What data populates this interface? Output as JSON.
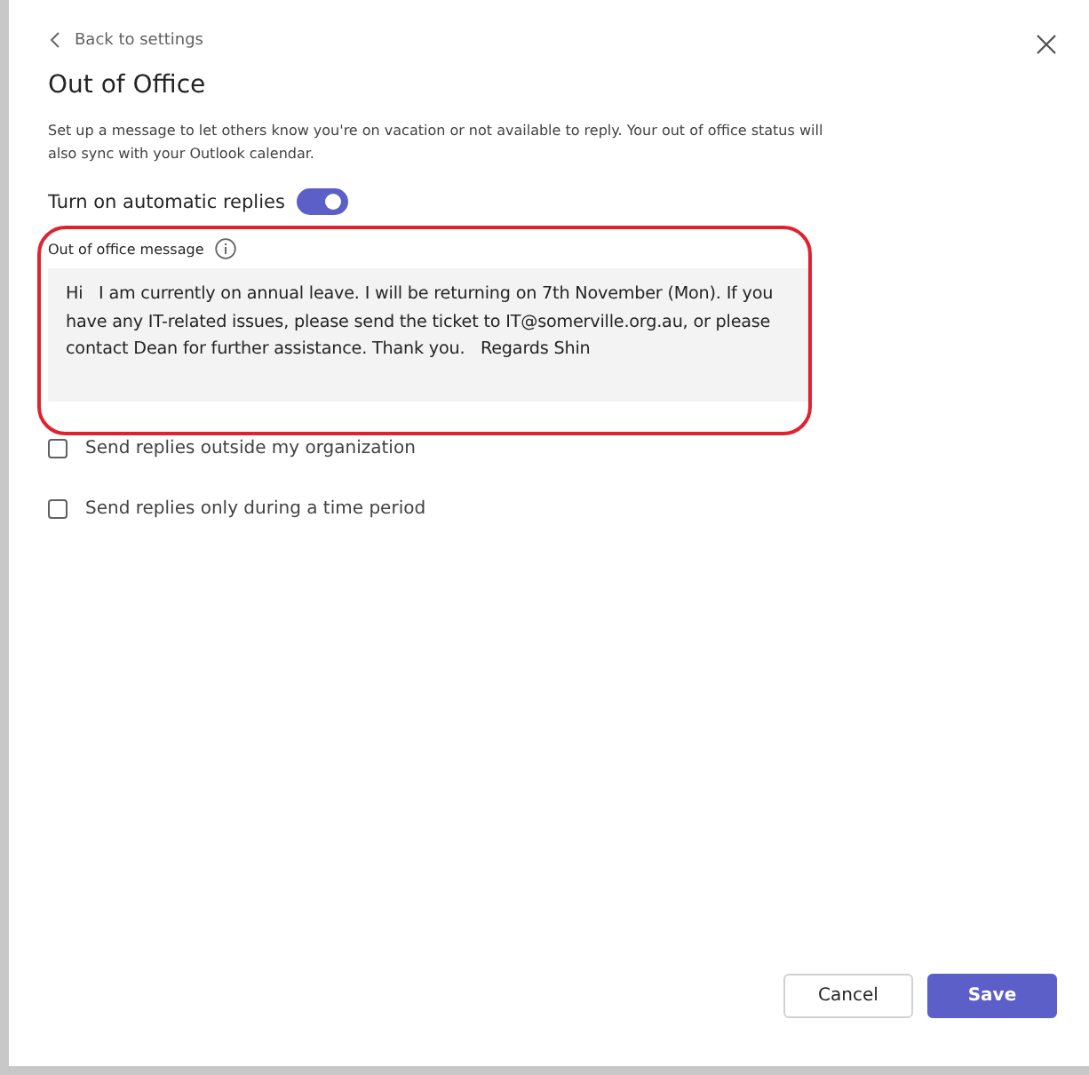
{
  "back_link": {
    "label": "Back to settings"
  },
  "title": "Out of Office",
  "description": "Set up a message to let others know you're on vacation or not available to reply. Your out of office status will also sync with your Outlook calendar.",
  "auto_replies": {
    "label": "Turn on automatic replies",
    "on": true
  },
  "message": {
    "label": "Out of office message",
    "value": "Hi   I am currently on annual leave. I will be returning on 7th November (Mon). If you have any IT-related issues, please send the ticket to IT@somerville.org.au, or please contact Dean for further assistance. Thank you.   Regards Shin"
  },
  "options": [
    {
      "label": "Send replies outside my organization",
      "checked": false
    },
    {
      "label": "Send replies only during a time period",
      "checked": false
    }
  ],
  "buttons": [
    {
      "label": "Cancel",
      "kind": "secondary"
    },
    {
      "label": "Save",
      "kind": "primary"
    }
  ]
}
